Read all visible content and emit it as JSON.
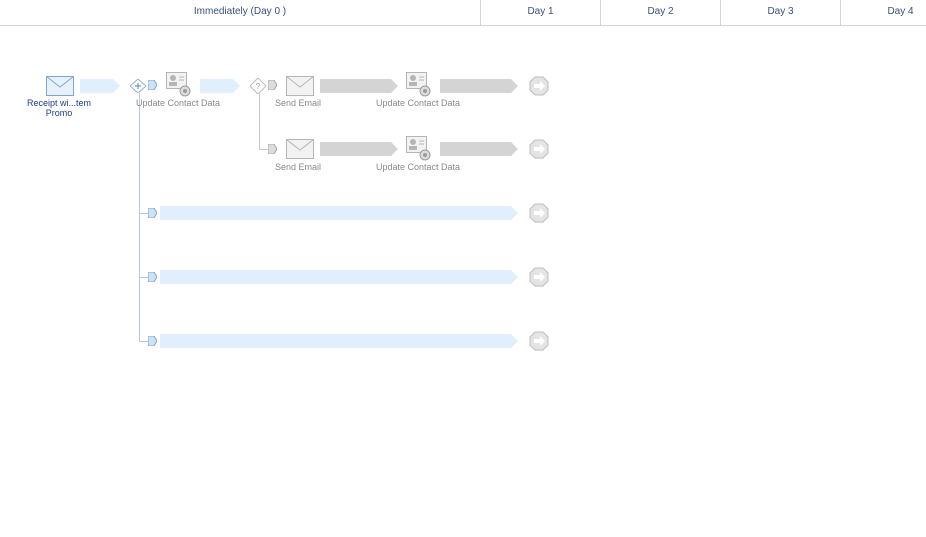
{
  "timeline": {
    "columns": [
      {
        "label": "Immediately (Day 0 )"
      },
      {
        "label": "Day 1"
      },
      {
        "label": "Day 2"
      },
      {
        "label": "Day 3"
      },
      {
        "label": "Day 4"
      }
    ]
  },
  "flow": {
    "start": {
      "label": "Receipt wi...tem Promo",
      "icon": "envelope-icon"
    },
    "step_update_1": {
      "label": "Update Contact Data",
      "icon": "contact-card-icon"
    },
    "branch_a": {
      "send": {
        "label": "Send Email",
        "icon": "envelope-icon"
      },
      "update": {
        "label": "Update Contact Data",
        "icon": "contact-card-icon"
      }
    },
    "branch_b": {
      "send": {
        "label": "Send Email",
        "icon": "envelope-icon"
      },
      "update": {
        "label": "Update Contact Data",
        "icon": "contact-card-icon"
      }
    },
    "empty_branches": 3
  },
  "colors": {
    "header_text": "#3a4f7f",
    "link_blue": "#1f3d8c",
    "inactive_grey": "#d4d4d4",
    "path_blue": "#e0effb"
  }
}
